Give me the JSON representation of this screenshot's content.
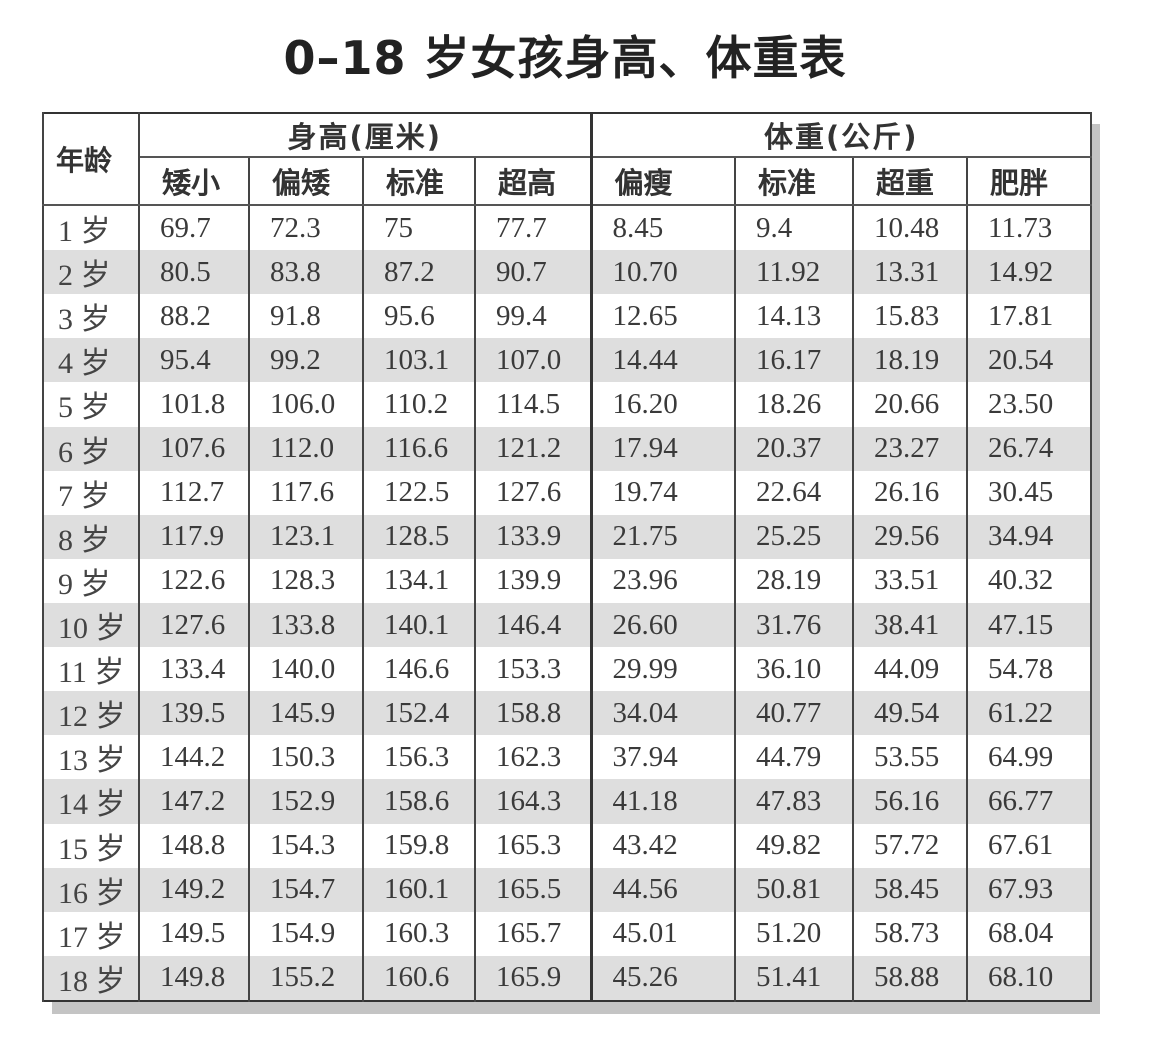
{
  "title": "0–18 岁女孩身高、体重表",
  "table": {
    "age_header": "年龄",
    "height_group": "身高(厘米)",
    "weight_group": "体重(公斤)",
    "height_columns": [
      "矮小",
      "偏矮",
      "标准",
      "超高"
    ],
    "weight_columns": [
      "偏瘦",
      "标准",
      "超重",
      "肥胖"
    ],
    "rows": [
      [
        "1 岁",
        "69.7",
        "72.3",
        "75",
        "77.7",
        "8.45",
        "9.4",
        "10.48",
        "11.73"
      ],
      [
        "2 岁",
        "80.5",
        "83.8",
        "87.2",
        "90.7",
        "10.70",
        "11.92",
        "13.31",
        "14.92"
      ],
      [
        "3 岁",
        "88.2",
        "91.8",
        "95.6",
        "99.4",
        "12.65",
        "14.13",
        "15.83",
        "17.81"
      ],
      [
        "4 岁",
        "95.4",
        "99.2",
        "103.1",
        "107.0",
        "14.44",
        "16.17",
        "18.19",
        "20.54"
      ],
      [
        "5 岁",
        "101.8",
        "106.0",
        "110.2",
        "114.5",
        "16.20",
        "18.26",
        "20.66",
        "23.50"
      ],
      [
        "6 岁",
        "107.6",
        "112.0",
        "116.6",
        "121.2",
        "17.94",
        "20.37",
        "23.27",
        "26.74"
      ],
      [
        "7 岁",
        "112.7",
        "117.6",
        "122.5",
        "127.6",
        "19.74",
        "22.64",
        "26.16",
        "30.45"
      ],
      [
        "8 岁",
        "117.9",
        "123.1",
        "128.5",
        "133.9",
        "21.75",
        "25.25",
        "29.56",
        "34.94"
      ],
      [
        "9 岁",
        "122.6",
        "128.3",
        "134.1",
        "139.9",
        "23.96",
        "28.19",
        "33.51",
        "40.32"
      ],
      [
        "10 岁",
        "127.6",
        "133.8",
        "140.1",
        "146.4",
        "26.60",
        "31.76",
        "38.41",
        "47.15"
      ],
      [
        "11 岁",
        "133.4",
        "140.0",
        "146.6",
        "153.3",
        "29.99",
        "36.10",
        "44.09",
        "54.78"
      ],
      [
        "12 岁",
        "139.5",
        "145.9",
        "152.4",
        "158.8",
        "34.04",
        "40.77",
        "49.54",
        "61.22"
      ],
      [
        "13 岁",
        "144.2",
        "150.3",
        "156.3",
        "162.3",
        "37.94",
        "44.79",
        "53.55",
        "64.99"
      ],
      [
        "14 岁",
        "147.2",
        "152.9",
        "158.6",
        "164.3",
        "41.18",
        "47.83",
        "56.16",
        "66.77"
      ],
      [
        "15 岁",
        "148.8",
        "154.3",
        "159.8",
        "165.3",
        "43.42",
        "49.82",
        "57.72",
        "67.61"
      ],
      [
        "16 岁",
        "149.2",
        "154.7",
        "160.1",
        "165.5",
        "44.56",
        "50.81",
        "58.45",
        "67.93"
      ],
      [
        "17 岁",
        "149.5",
        "154.9",
        "160.3",
        "165.7",
        "45.01",
        "51.20",
        "58.73",
        "68.04"
      ],
      [
        "18 岁",
        "149.8",
        "155.2",
        "160.6",
        "165.9",
        "45.26",
        "51.41",
        "58.88",
        "68.10"
      ]
    ]
  }
}
